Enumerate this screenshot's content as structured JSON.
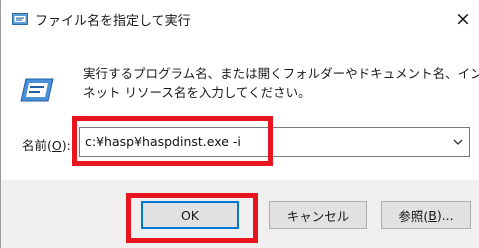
{
  "window": {
    "title": "ファイル名を指定して実行",
    "close_glyph": "×",
    "title_icon": "run-dialog-icon"
  },
  "description": {
    "line1": "実行するプログラム名、または開くフォルダーやドキュメント名、インター",
    "line2": "ネット リソース名を入力してください。",
    "icon": "run-dialog-icon"
  },
  "name_field": {
    "label_prefix": "名前(",
    "label_accel": "O",
    "label_suffix": "):",
    "value": "c:¥hasp¥haspdinst.exe -i",
    "dropdown_icon": "chevron-down-icon"
  },
  "buttons": {
    "ok": "OK",
    "cancel": "キャンセル",
    "browse_prefix": "参照(",
    "browse_accel": "B",
    "browse_suffix": ")..."
  },
  "colors": {
    "highlight": "#e8141e",
    "focus_border": "#0078d7",
    "footer_bg": "#f0f0f0",
    "button_bg": "#e1e1e1"
  }
}
